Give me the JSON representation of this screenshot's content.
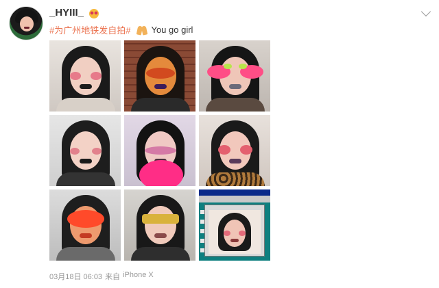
{
  "post": {
    "username": "_HYIII_",
    "hashtag": "#为广州地铁发自拍#",
    "text": "You go girl",
    "timestamp": "03月18日 06:03",
    "source_prefix": "来自",
    "source": "iPhone X"
  },
  "icons": {
    "username_badge": "heart-eyes-face-emoji",
    "text_emoji": "folded-hands-emoji",
    "menu": "chevron-down-icon"
  },
  "colors": {
    "hashtag": "#eb7350",
    "footer_text": "#999999"
  },
  "photos_count": 9
}
